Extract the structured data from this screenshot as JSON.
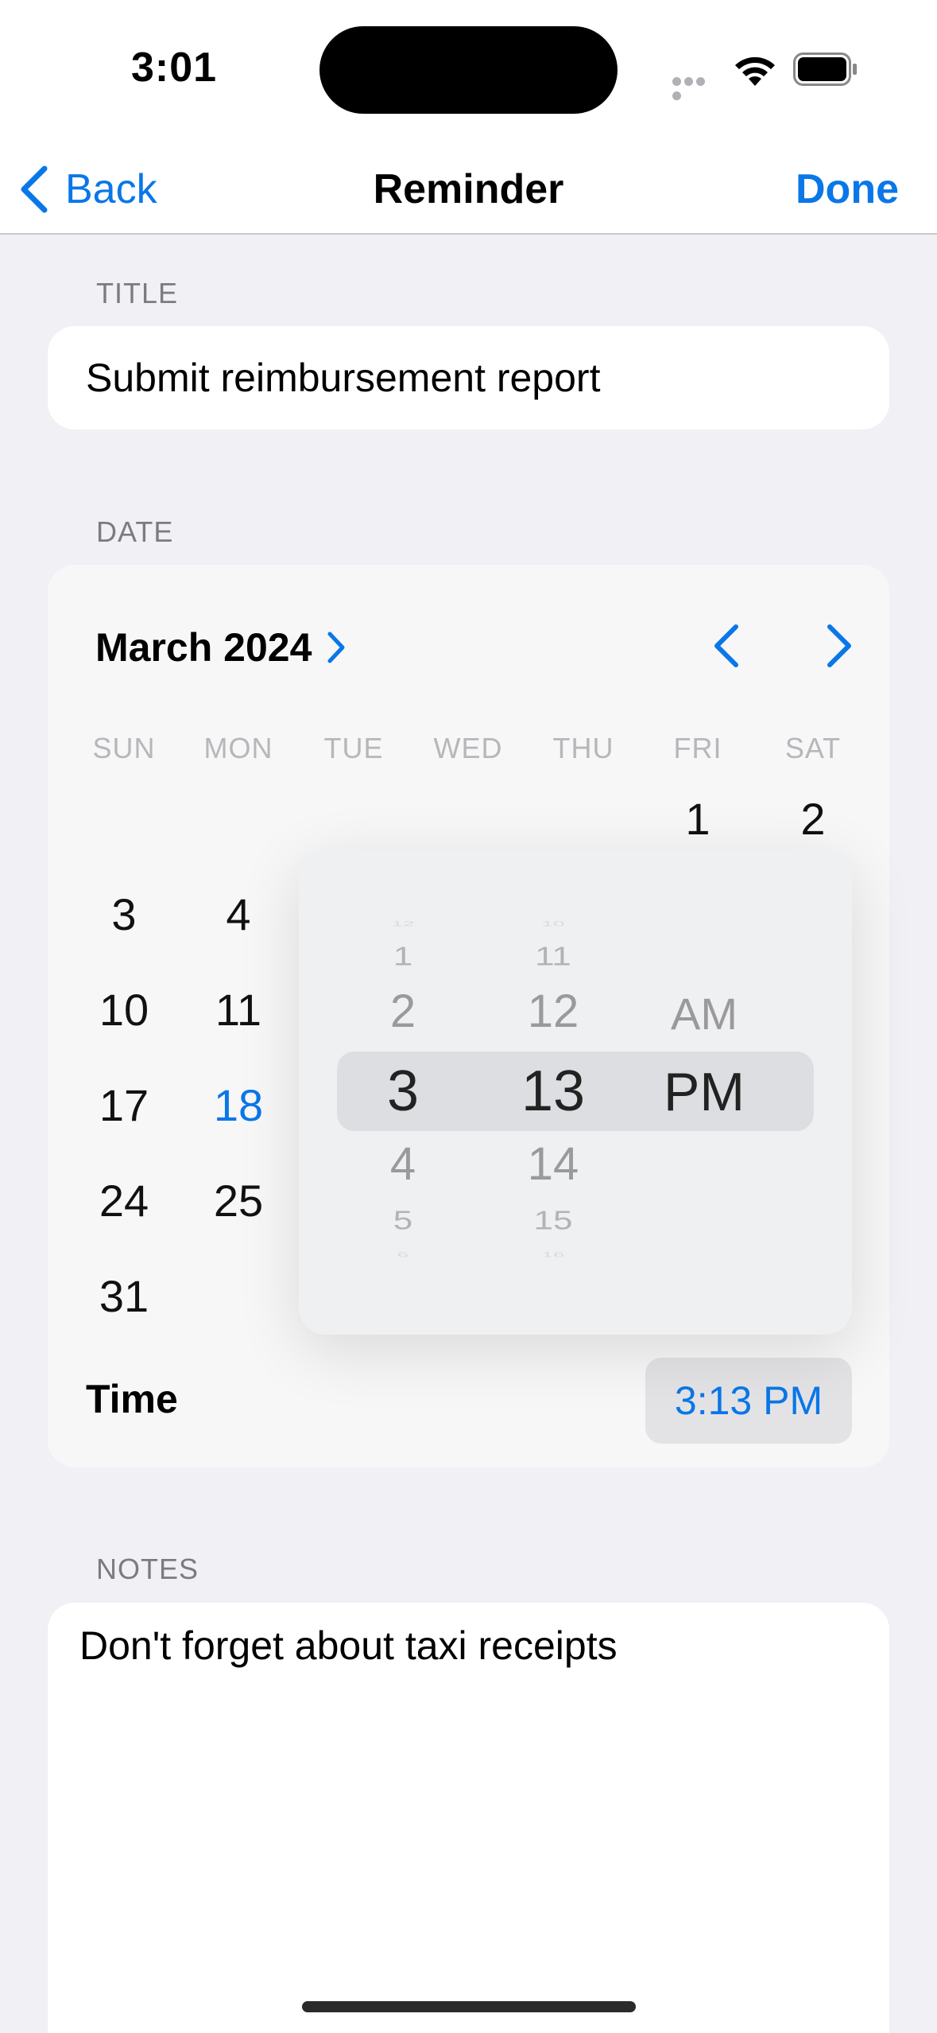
{
  "status_bar": {
    "time": "3:01"
  },
  "nav": {
    "back_label": "Back",
    "title": "Reminder",
    "done_label": "Done"
  },
  "title_section": {
    "header": "TITLE",
    "value": "Submit reimbursement report"
  },
  "date_section": {
    "header": "DATE",
    "month_label": "March 2024",
    "weekdays": [
      "SUN",
      "MON",
      "TUE",
      "WED",
      "THU",
      "FRI",
      "SAT"
    ],
    "days_visible": [
      "1",
      "2",
      "3",
      "4",
      "10",
      "11",
      "17",
      "18",
      "24",
      "25",
      "31"
    ],
    "selected_day": "18",
    "time_label": "Time",
    "time_value": "3:13 PM"
  },
  "time_picker": {
    "hours": [
      "12",
      "1",
      "2",
      "3",
      "4",
      "5",
      "6"
    ],
    "minutes": [
      "10",
      "11",
      "12",
      "13",
      "14",
      "15",
      "16"
    ],
    "periods": [
      "AM",
      "PM"
    ],
    "selected_hour": "3",
    "selected_minute": "13",
    "selected_period": "PM"
  },
  "notes_section": {
    "header": "NOTES",
    "value": "Don't forget about taxi receipts"
  },
  "colors": {
    "accent": "#0a77e8",
    "background": "#f0f0f5",
    "card": "#ffffff"
  }
}
